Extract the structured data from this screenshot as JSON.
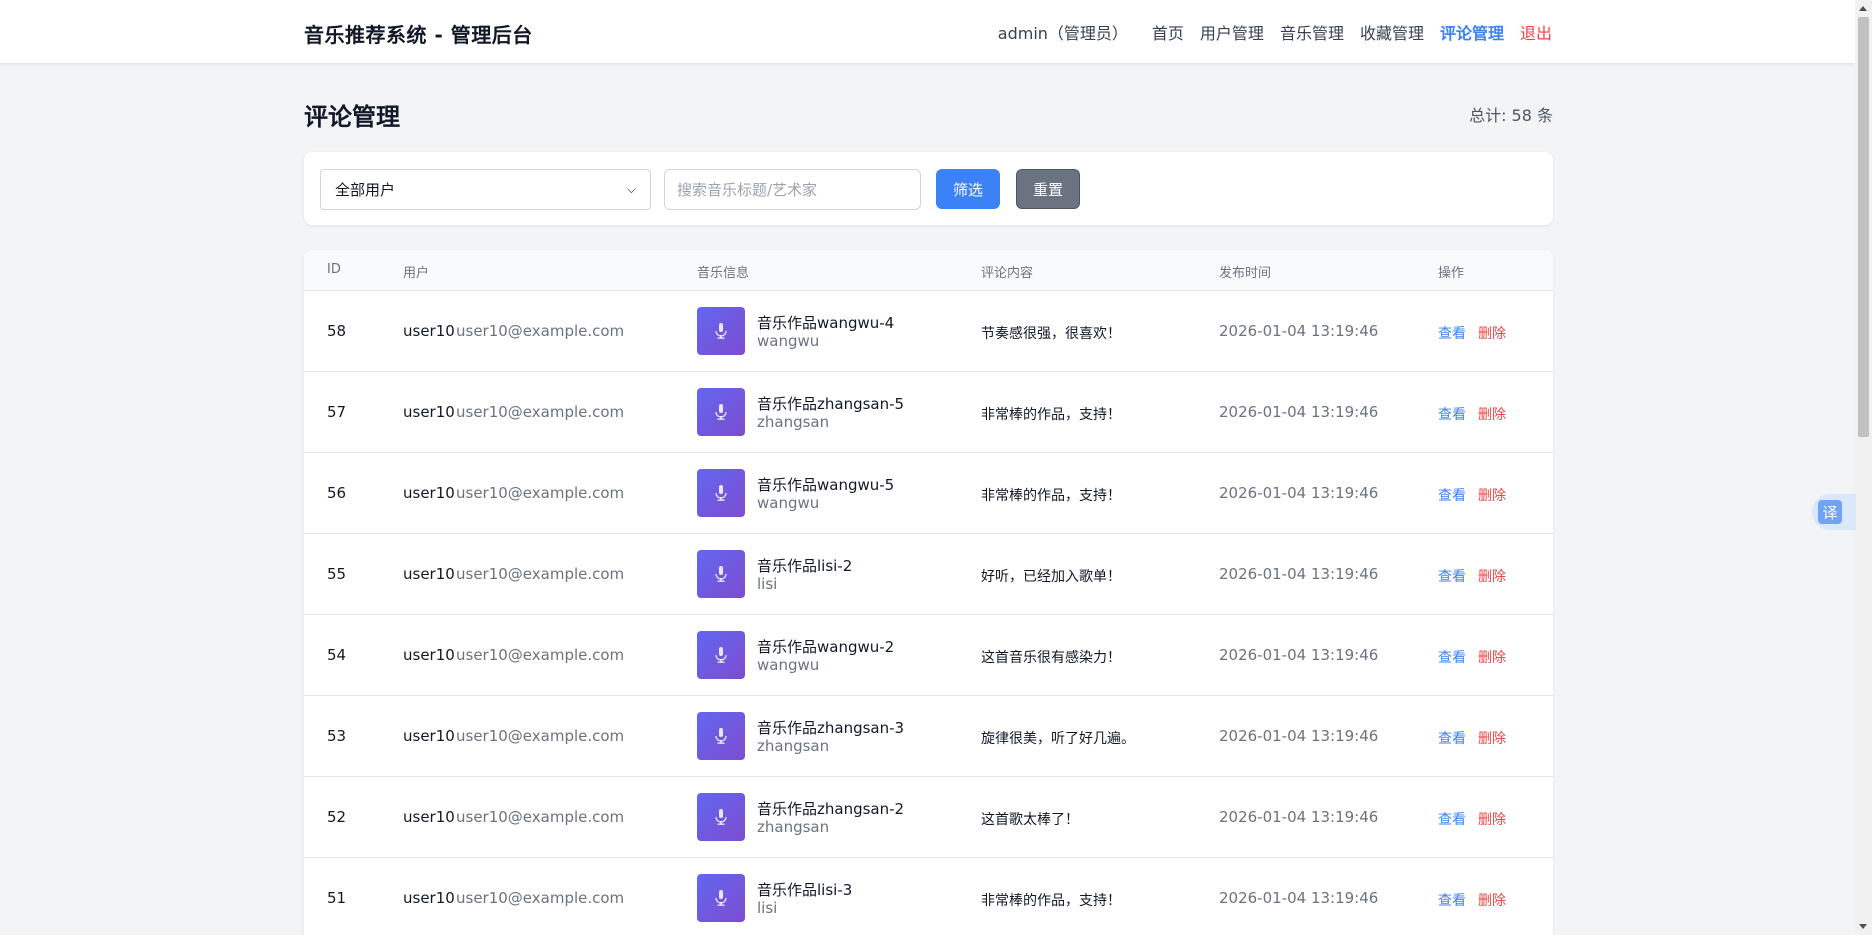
{
  "header": {
    "brand": "音乐推荐系统 - 管理后台",
    "user_label": "admin（管理员）",
    "nav": [
      {
        "label": "首页"
      },
      {
        "label": "用户管理"
      },
      {
        "label": "音乐管理"
      },
      {
        "label": "收藏管理"
      },
      {
        "label": "评论管理",
        "active": true
      },
      {
        "label": "退出"
      }
    ]
  },
  "page": {
    "title": "评论管理",
    "total": "总计: 58 条"
  },
  "filter": {
    "user_select_value": "全部用户",
    "search_placeholder": "搜索音乐标题/艺术家",
    "filter_label": "筛选",
    "reset_label": "重置"
  },
  "table": {
    "headers": {
      "id": "ID",
      "user": "用户",
      "music": "音乐信息",
      "comment": "评论内容",
      "time": "发布时间",
      "actions": "操作"
    },
    "view_label": "查看",
    "delete_label": "删除",
    "rows": [
      {
        "id": "58",
        "user": "user10",
        "email": "user10@example.com",
        "title": "音乐作品wangwu-4",
        "artist": "wangwu",
        "comment": "节奏感很强，很喜欢！",
        "time": "2026-01-04 13:19:46"
      },
      {
        "id": "57",
        "user": "user10",
        "email": "user10@example.com",
        "title": "音乐作品zhangsan-5",
        "artist": "zhangsan",
        "comment": "非常棒的作品，支持！",
        "time": "2026-01-04 13:19:46"
      },
      {
        "id": "56",
        "user": "user10",
        "email": "user10@example.com",
        "title": "音乐作品wangwu-5",
        "artist": "wangwu",
        "comment": "非常棒的作品，支持！",
        "time": "2026-01-04 13:19:46"
      },
      {
        "id": "55",
        "user": "user10",
        "email": "user10@example.com",
        "title": "音乐作品lisi-2",
        "artist": "lisi",
        "comment": "好听，已经加入歌单！",
        "time": "2026-01-04 13:19:46"
      },
      {
        "id": "54",
        "user": "user10",
        "email": "user10@example.com",
        "title": "音乐作品wangwu-2",
        "artist": "wangwu",
        "comment": "这首音乐很有感染力！",
        "time": "2026-01-04 13:19:46"
      },
      {
        "id": "53",
        "user": "user10",
        "email": "user10@example.com",
        "title": "音乐作品zhangsan-3",
        "artist": "zhangsan",
        "comment": "旋律很美，听了好几遍。",
        "time": "2026-01-04 13:19:46"
      },
      {
        "id": "52",
        "user": "user10",
        "email": "user10@example.com",
        "title": "音乐作品zhangsan-2",
        "artist": "zhangsan",
        "comment": "这首歌太棒了！",
        "time": "2026-01-04 13:19:46"
      },
      {
        "id": "51",
        "user": "user10",
        "email": "user10@example.com",
        "title": "音乐作品lisi-3",
        "artist": "lisi",
        "comment": "非常棒的作品，支持！",
        "time": "2026-01-04 13:19:46"
      }
    ]
  },
  "translate_button": "译",
  "colors": {
    "accent": "#3b82f6",
    "danger": "#ef4444",
    "cover_gradient_start": "#6366f1",
    "cover_gradient_end": "#7c4dcf"
  }
}
